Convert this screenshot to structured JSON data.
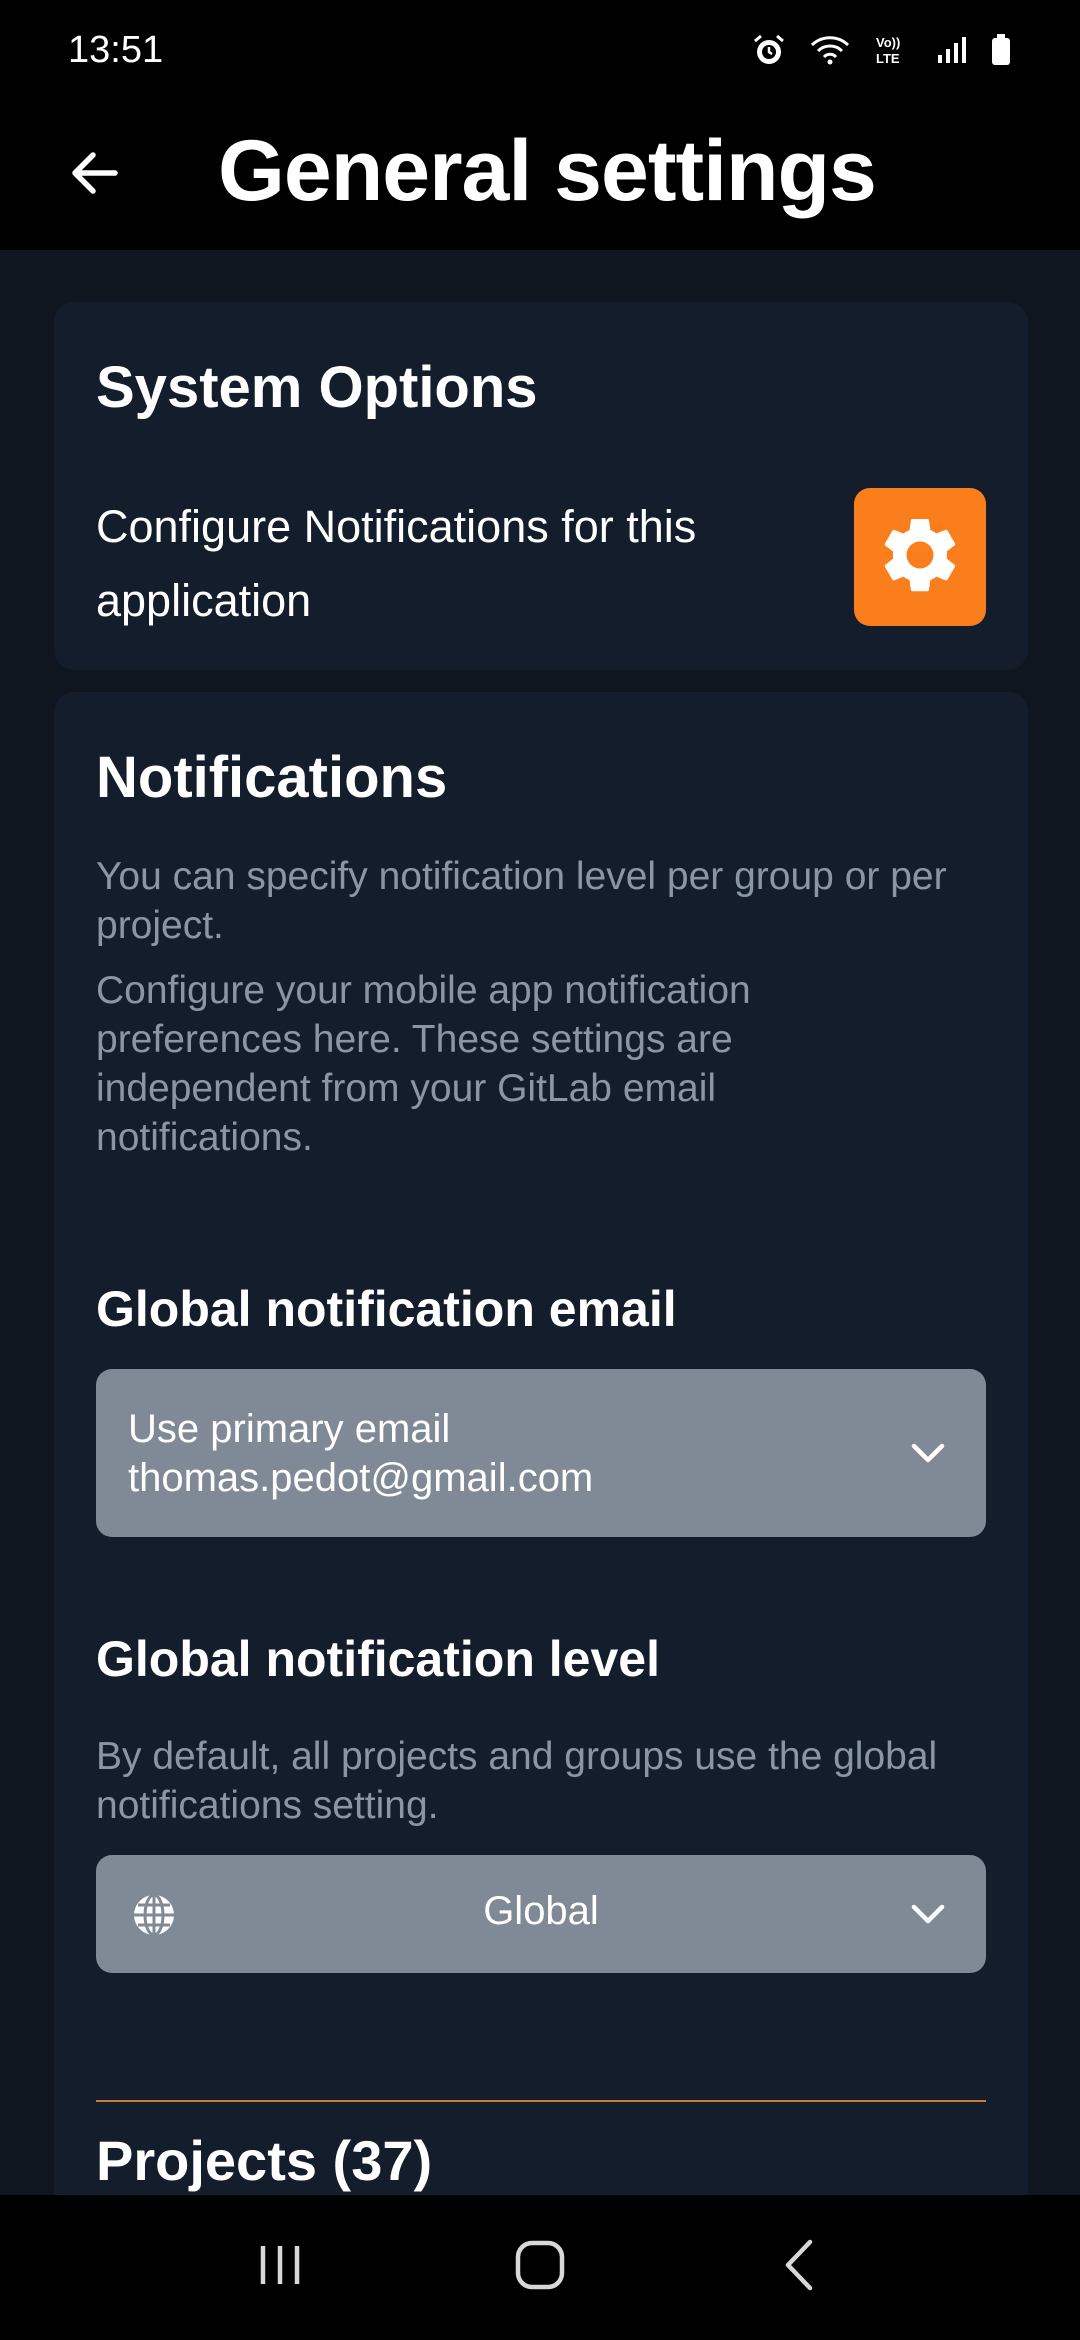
{
  "status_bar": {
    "time": "13:51",
    "icons": [
      "alarm-icon",
      "wifi-icon",
      "volte-icon",
      "signal-icon",
      "battery-icon"
    ]
  },
  "header": {
    "title": "General settings",
    "back_icon": "arrow-left-icon"
  },
  "system_options": {
    "title": "System Options",
    "description": "Configure Notifications for this application",
    "button_icon": "gear-icon",
    "accent_color": "#fb7e1c"
  },
  "notifications": {
    "title": "Notifications",
    "intro": "You can specify notification level per group or per project.",
    "mobile_note": "Configure your mobile app notification preferences here. These settings are independent from your GitLab email notifications.",
    "email": {
      "label": "Global notification email",
      "selected": "Use primary email thomas.pedot@gmail.com"
    },
    "level": {
      "label": "Global notification level",
      "help": "By default, all projects and groups use the global notifications setting.",
      "selected": "Global",
      "icon": "globe-icon"
    },
    "projects_heading": "Projects (37)",
    "divider_color": "#c77a3a"
  },
  "nav_bar": {
    "items": [
      "recent-apps-icon",
      "home-icon",
      "back-icon"
    ]
  }
}
